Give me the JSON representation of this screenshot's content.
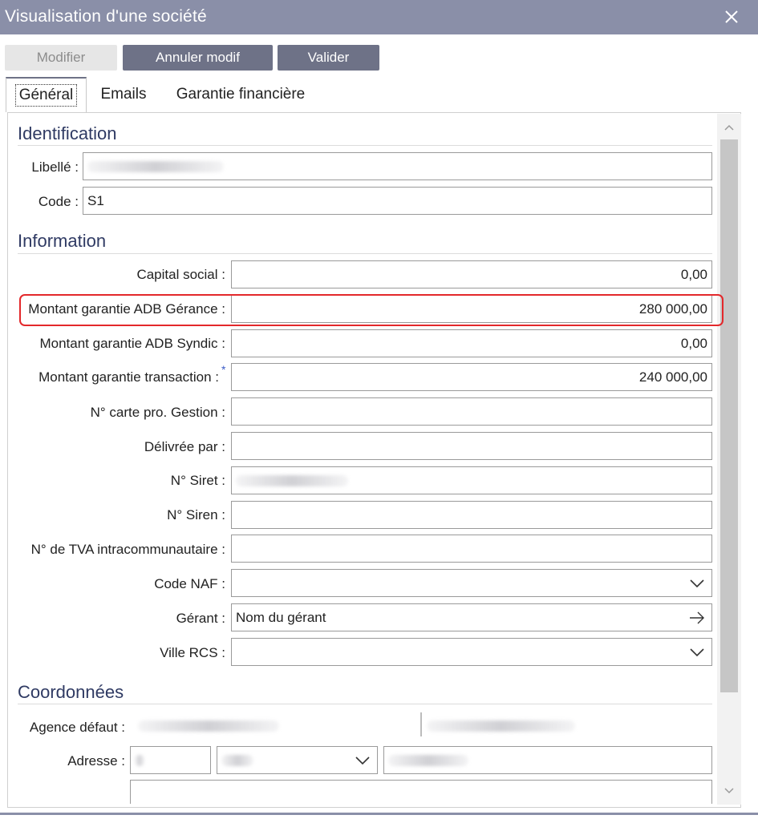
{
  "window": {
    "title": "Visualisation d'une société",
    "close_icon": "close-icon"
  },
  "toolbar": {
    "modifier": "Modifier",
    "annuler": "Annuler modif",
    "valider": "Valider"
  },
  "tabs": [
    {
      "label": "Général",
      "active": true
    },
    {
      "label": "Emails",
      "active": false
    },
    {
      "label": "Garantie financière",
      "active": false
    }
  ],
  "identification": {
    "title": "Identification",
    "libelle_label": "Libellé :",
    "code_label": "Code :",
    "code_value": "S1"
  },
  "information": {
    "title": "Information",
    "capital_label": "Capital social :",
    "capital_value": "0,00",
    "gerance_label": "Montant garantie ADB Gérance :",
    "gerance_value": "280 000,00",
    "syndic_label": "Montant garantie ADB Syndic :",
    "syndic_value": "0,00",
    "transaction_label": "Montant garantie transaction :",
    "transaction_marker": "*",
    "transaction_value": "240 000,00",
    "carte_label": "N° carte pro. Gestion :",
    "delivree_label": "Délivrée par :",
    "siret_label": "N° Siret :",
    "siren_label": "N° Siren :",
    "tva_label": "N° de TVA intracommunautaire :",
    "naf_label": "Code NAF :",
    "gerant_label": "Gérant :",
    "gerant_value": "Nom du gérant",
    "rcs_label": "Ville RCS :"
  },
  "coordonnees": {
    "title": "Coordonnées",
    "agence_label": "Agence défaut :",
    "adresse_label": "Adresse :"
  },
  "colors": {
    "titlebar": "#8a8fa8",
    "primary_button": "#6e7287",
    "section_title": "#2f3a63",
    "highlight": "#e3282b"
  }
}
